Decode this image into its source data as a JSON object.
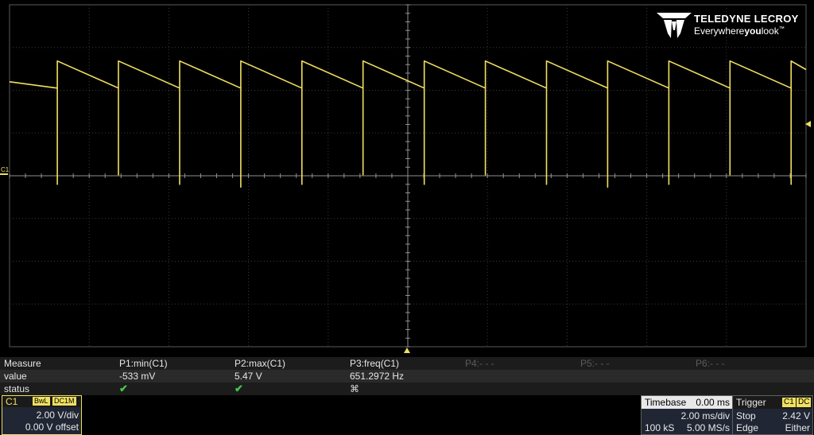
{
  "brand": {
    "name": "TELEDYNE LECROY",
    "tagline_pre": "Everywhere",
    "tagline_bold": "you",
    "tagline_post": "look",
    "tm": "™"
  },
  "channel_marker": "C1",
  "measure": {
    "headers": {
      "label": "Measure",
      "p1": "P1:min(C1)",
      "p2": "P2:max(C1)",
      "p3": "P3:freq(C1)",
      "p4": "P4:- - -",
      "p5": "P5:- - -",
      "p6": "P6:- - -"
    },
    "value_row": {
      "label": "value",
      "p1": "-533 mV",
      "p2": "5.47 V",
      "p3": "651.2972 Hz"
    },
    "status_row": {
      "label": "status",
      "p1": "✔",
      "p2": "✔",
      "p3": "⌘"
    }
  },
  "channel": {
    "name": "C1",
    "bwl": "BwL",
    "coupling": "DC1M",
    "vdiv": "2.00 V/div",
    "offset": "0.00 V offset"
  },
  "timebase": {
    "title": "Timebase",
    "position": "0.00 ms",
    "tdiv": "2.00 ms/div",
    "samples": "100 kS",
    "rate": "5.00 MS/s"
  },
  "trigger": {
    "title": "Trigger",
    "source": "C1",
    "coupling": "DC",
    "mode": "Stop",
    "level": "2.42 V",
    "type": "Edge",
    "slope": "Either"
  },
  "colors": {
    "trace": "#f0e060",
    "grid": "#5a5a5a",
    "background": "#000000"
  },
  "chart_data": {
    "type": "line",
    "title": "",
    "xlabel": "",
    "ylabel": "",
    "volts_per_div": 2.0,
    "ms_per_div": 2.0,
    "xlim": [
      -10,
      10
    ],
    "ylim": [
      -8,
      8
    ],
    "series": [
      {
        "kind": "sawtooth",
        "period_ms": 1.5354,
        "first_peak_ms": -8.8,
        "peak_v": 5.25,
        "trough_v": 4.1,
        "min_v": -0.533,
        "max_v": 5.47
      }
    ]
  }
}
